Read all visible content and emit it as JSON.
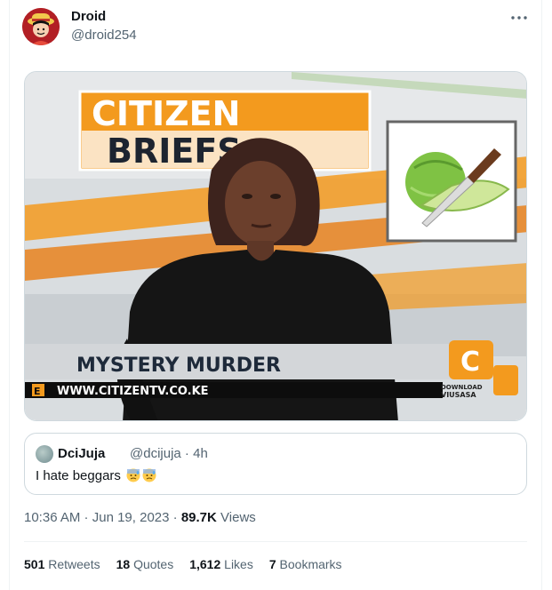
{
  "author": {
    "name": "Droid",
    "handle": "@droid254"
  },
  "media": {
    "banner_line1": "CITIZEN",
    "banner_line2": "BRIEFS",
    "lower_third": "MYSTERY MURDER",
    "ticker_prefix": "E",
    "ticker_url": "WWW.CITIZENTV.CO.KE",
    "download_label": "DOWNLOAD",
    "viusasa_label": "VIUSASA",
    "channel_logo": "C"
  },
  "quote": {
    "name": "DciJuja",
    "handle": "@dcijuja",
    "time": "4h",
    "text": "I hate beggars",
    "emoji": [
      "anxious-face-with-sweat",
      "anxious-face-with-sweat"
    ]
  },
  "meta": {
    "time": "10:36 AM",
    "date": "Jun 19, 2023",
    "views_count": "89.7K",
    "views_label": "Views"
  },
  "stats": [
    {
      "count": "501",
      "label": "Retweets"
    },
    {
      "count": "18",
      "label": "Quotes"
    },
    {
      "count": "1,612",
      "label": "Likes"
    },
    {
      "count": "7",
      "label": "Bookmarks"
    }
  ],
  "colors": {
    "text": "#0f1419",
    "secondary": "#536471",
    "border": "#cfd9de",
    "citizen_orange": "#f39a1e"
  },
  "icons": {
    "more": "more-horizontal-icon",
    "avatar": "luffy-avatar-icon"
  }
}
